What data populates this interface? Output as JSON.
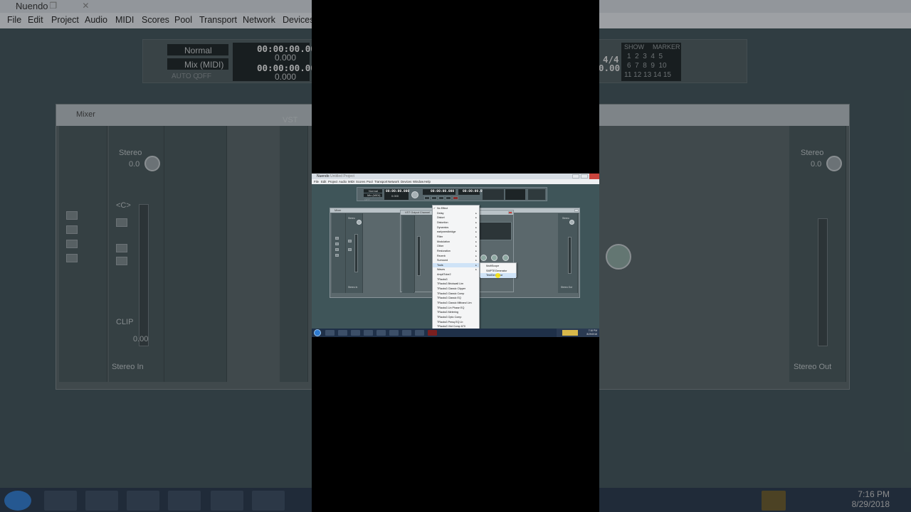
{
  "app": {
    "title": "Nuendo",
    "document": "Untitled Project",
    "window_buttons": "— ❐ ✕"
  },
  "menu": [
    "File",
    "Edit",
    "Project",
    "Audio",
    "MIDI",
    "Scores",
    "Pool",
    "Transport",
    "Network",
    "Devices",
    "Window",
    "Help"
  ],
  "transport": {
    "mode_1": "Normal",
    "mode_2": "Mix (MIDI)",
    "auto_label": "AUTO Q",
    "auto_value": "OFF",
    "time_1": "00:00:00.000",
    "time_1_sub": "0.000",
    "time_2": "00:00:00.000",
    "time_2_sub": "0.000",
    "sig": "4/4",
    "tempo": "0.00",
    "show_label": "SHOW",
    "marker_label": "MARKER",
    "marker_row_1": "1  2  3  4  5",
    "marker_row_2": "6  7  8  9  10",
    "marker_row_3": "11 12 13 14 15"
  },
  "mixer": {
    "title": "Mixer",
    "left_strip_label": "Stereo",
    "left_strip_value": "0.0",
    "left_level": "0.00",
    "left_bus": "Stereo In",
    "right_strip_label": "Stereo",
    "right_strip_value": "0.0",
    "right_bus": "Stereo Out",
    "c_label": "<C>",
    "clip_label": "CLIP"
  },
  "vst_window": {
    "title": "VST Output Channel",
    "short_title": "VST",
    "knob_value": "0.0"
  },
  "effects_menu": {
    "items": [
      {
        "label": "No Effect",
        "submenu": false,
        "checked": true
      },
      {
        "label": "Delay",
        "submenu": true
      },
      {
        "label": "Distort",
        "submenu": true
      },
      {
        "label": "Distortion",
        "submenu": true
      },
      {
        "label": "Dynamics",
        "submenu": true
      },
      {
        "label": "earlyneedbridge",
        "submenu": true
      },
      {
        "label": "Filter",
        "submenu": true
      },
      {
        "label": "Modulation",
        "submenu": true
      },
      {
        "label": "Other",
        "submenu": true
      },
      {
        "label": "Restoration",
        "submenu": true
      },
      {
        "label": "Reverb",
        "submenu": true
      },
      {
        "label": "Surround",
        "submenu": true
      },
      {
        "label": "Tools",
        "submenu": true,
        "highlighted": true
      },
      {
        "label": "Waves",
        "submenu": true
      },
      {
        "label": "AmpliTube2",
        "submenu": false
      },
      {
        "label": "TRacks3",
        "submenu": false
      },
      {
        "label": "TRacks3 Brickwall Lim",
        "submenu": false
      },
      {
        "label": "TRacks3 Classic Clipper",
        "submenu": false
      },
      {
        "label": "TRacks3 Classic Comp",
        "submenu": false
      },
      {
        "label": "TRacks3 Classic EQ",
        "submenu": false
      },
      {
        "label": "TRacks3 Classic Mltband Lim",
        "submenu": false
      },
      {
        "label": "TRacks3 Lin Phase EQ",
        "submenu": false
      },
      {
        "label": "TRacks3 Metering",
        "submenu": false
      },
      {
        "label": "TRacks3 Opto Comp",
        "submenu": false
      },
      {
        "label": "TRacks3 Pmsq EQ Lb",
        "submenu": false
      },
      {
        "label": "TRacks3 Vint Comp 670",
        "submenu": false
      }
    ]
  },
  "tools_submenu": {
    "items": [
      {
        "label": "MultiScope"
      },
      {
        "label": "SMPTEGenerator"
      },
      {
        "label": "TestGenerator",
        "highlighted": true
      }
    ]
  },
  "taskbar": {
    "clock_time": "7:16 PM",
    "clock_date": "8/29/2018"
  }
}
